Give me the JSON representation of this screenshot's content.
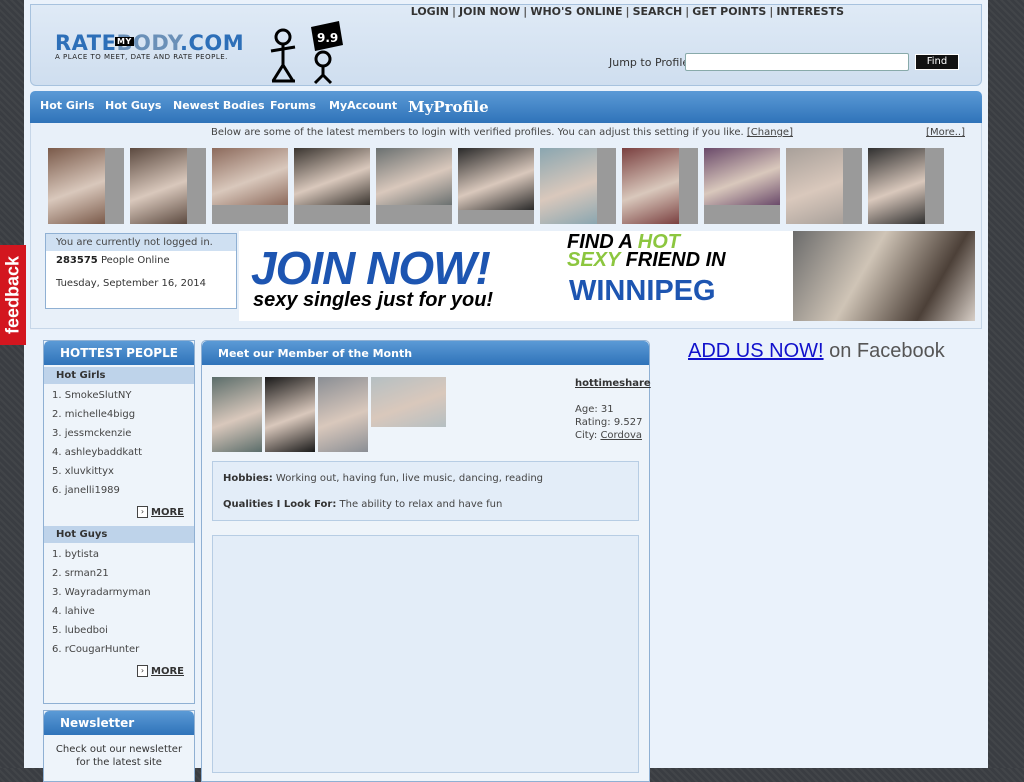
{
  "top_nav": {
    "links": [
      "LOGIN",
      "JOIN NOW",
      "WHO'S ONLINE",
      "SEARCH",
      "GET POINTS",
      "INTERESTS"
    ]
  },
  "logo": {
    "left": "RATE",
    "my": "MY",
    "right": "BODY",
    "suffix": ".COM",
    "tagline": "A PLACE TO MEET, DATE AND RATE PEOPLE.",
    "score": "9.9"
  },
  "jump": {
    "label": "Jump to Profile:",
    "value": "",
    "button": "Find"
  },
  "nav": {
    "items": [
      "Hot Girls",
      "Hot Guys",
      "Newest Bodies",
      "Forums",
      "MyAccount"
    ],
    "profile": "MyProfile"
  },
  "members": {
    "note": "Below are some of the latest members to login with verified profiles. You can adjust this setting if you like.",
    "change": "[Change]",
    "more": "[More..]",
    "photo_colors": [
      "#7a5a4a",
      "#5c4a40",
      "#8c6a5c",
      "#3a3530",
      "#6a7070",
      "#2a2a2a",
      "#8aa6b0",
      "#7a4040",
      "#6a4a6a",
      "#a8a09a",
      "#303030"
    ]
  },
  "status": {
    "header": "You are currently not logged in.",
    "online_count": "283575",
    "online_label": "People Online",
    "date": "Tuesday, September 16, 2014"
  },
  "banner": {
    "join": "JOIN NOW!",
    "sub": "sexy singles just for you!",
    "find_a": "FIND A",
    "hot": "HOT",
    "sexy": "SEXY",
    "friend_in": "FRIEND IN",
    "city": "WINNIPEG"
  },
  "hottest": {
    "title": "HOTTEST PEOPLE",
    "girls_title": "Hot Girls",
    "girls": [
      "1. SmokeSlutNY",
      "2. michelle4bigg",
      "3. jessmckenzie",
      "4. ashleybaddkatt",
      "5. xluvkittyx",
      "6. janelli1989"
    ],
    "guys_title": "Hot Guys",
    "guys": [
      "1. bytista",
      "2. srman21",
      "3. Wayradarmyman",
      "4. lahive",
      "5. lubedboi",
      "6. rCougarHunter"
    ],
    "more": "MORE"
  },
  "newsletter": {
    "title": "Newsletter",
    "text": "Check out our newsletter for the latest site"
  },
  "member_of_month": {
    "title": "Meet our Member of the Month",
    "username": "hottimeshare",
    "age_label": "Age:",
    "age": "31",
    "rating_label": "Rating:",
    "rating": "9.527",
    "city_label": "City:",
    "city": "Cordova",
    "hobbies_label": "Hobbies:",
    "hobbies": "Working out, having fun, live music, dancing, reading",
    "qualities_label": "Qualities I Look For:",
    "qualities": "The ability to relax and have fun",
    "photo_colors": [
      "#5b6d6a",
      "#1a1a1a",
      "#8a8e94",
      "#b5bfc2"
    ]
  },
  "facebook": {
    "link": "ADD US NOW!",
    "text": "on Facebook"
  },
  "feedback": {
    "label": "feedback"
  }
}
